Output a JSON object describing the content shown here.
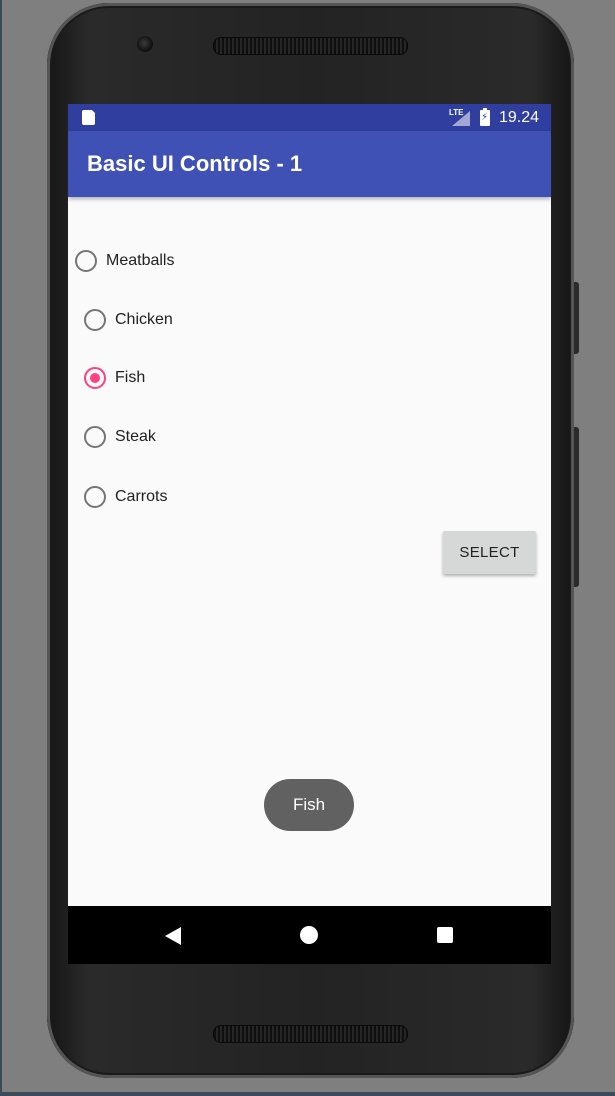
{
  "status_bar": {
    "network": "LTE",
    "time": "19.24",
    "icons": [
      "sd-card-icon",
      "signal-icon",
      "battery-charging-icon"
    ]
  },
  "toolbar": {
    "title": "Basic UI Controls - 1"
  },
  "radio_group": {
    "options": [
      {
        "label": "Meatballs",
        "checked": false
      },
      {
        "label": "Chicken",
        "checked": false
      },
      {
        "label": "Fish",
        "checked": true
      },
      {
        "label": "Steak",
        "checked": false
      },
      {
        "label": "Carrots",
        "checked": false
      }
    ]
  },
  "select_button": {
    "label": "SELECT"
  },
  "toast": {
    "text": "Fish"
  },
  "nav_bar": {
    "icons": [
      "back-icon",
      "home-icon",
      "recents-icon"
    ]
  },
  "colors": {
    "status_bar": "#303f9f",
    "toolbar": "#3f51b5",
    "accent": "#ff4081",
    "toast": "#616161",
    "button": "#d6d7d7"
  }
}
